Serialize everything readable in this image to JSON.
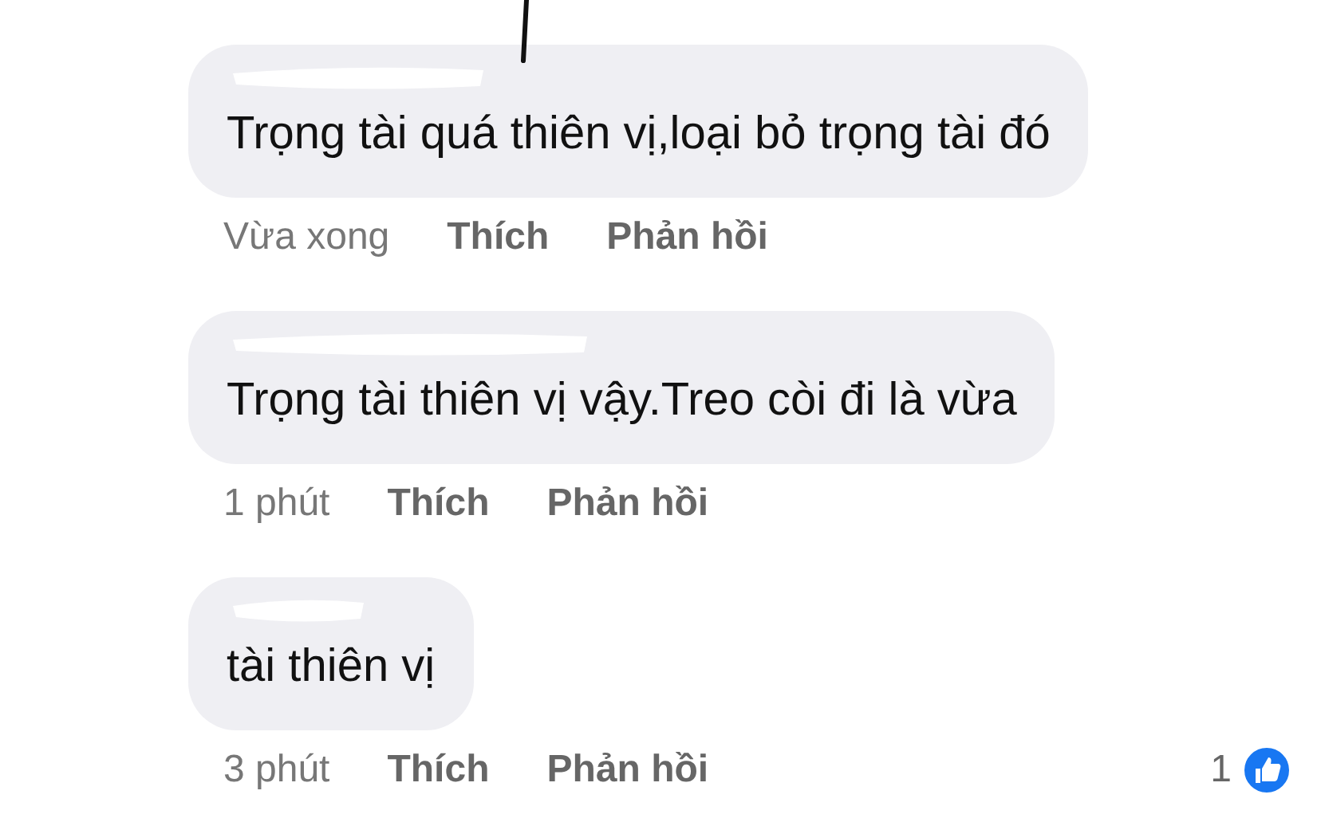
{
  "comments": [
    {
      "text": "Trọng tài quá thiên vị,loại bỏ trọng tài đó",
      "time": "Vừa xong",
      "like": "Thích",
      "reply": "Phản hồi"
    },
    {
      "text": "Trọng tài thiên vị vậy.Treo còi đi là vừa",
      "time": "1 phút",
      "like": "Thích",
      "reply": "Phản hồi"
    },
    {
      "text": "tài thiên vị",
      "time": "3 phút",
      "like": "Thích",
      "reply": "Phản hồi",
      "reaction_count": "1"
    }
  ]
}
